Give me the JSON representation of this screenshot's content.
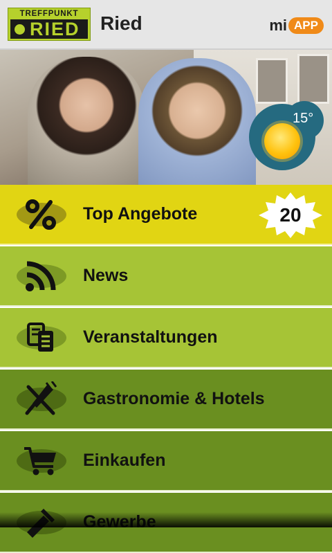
{
  "header": {
    "logo_top": "TREFFPUNKT",
    "logo_bottom": "RIED",
    "title": "Ried",
    "brand_mi": "mi",
    "brand_app": "APP"
  },
  "weather": {
    "temperature": "15°",
    "icon": "sun-icon"
  },
  "menu": [
    {
      "label": "Top Angebote",
      "icon": "percent-icon",
      "badge": "20",
      "color": "#e1d513"
    },
    {
      "label": "News",
      "icon": "rss-icon",
      "color": "#a6c436"
    },
    {
      "label": "Veranstaltungen",
      "icon": "tickets-icon",
      "color": "#a6c436"
    },
    {
      "label": "Gastronomie & Hotels",
      "icon": "fork-knife-icon",
      "color": "#6a8f20"
    },
    {
      "label": "Einkaufen",
      "icon": "shopping-cart-icon",
      "color": "#6a8f20"
    },
    {
      "label": "Gewerbe",
      "icon": "tools-icon",
      "color": "#6a8f20"
    }
  ]
}
